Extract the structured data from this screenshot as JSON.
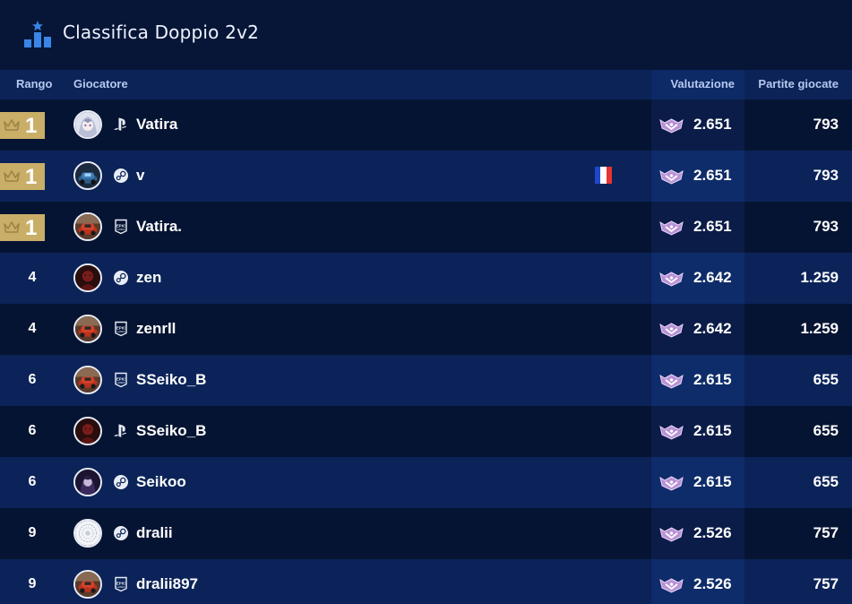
{
  "header": {
    "title": "Classifica Doppio 2v2",
    "icon": "leaderboard-podium-icon"
  },
  "columns": {
    "rank": "Rango",
    "player": "Giocatore",
    "rating": "Valutazione",
    "games": "Partite giocate"
  },
  "colors": {
    "background": "#071637",
    "header_row": "#0b2357",
    "gold_badge": "#c9ae68",
    "row_dark": "#061433",
    "row_light": "#0b2358"
  },
  "rows": [
    {
      "rank": "1",
      "top": true,
      "platform": "playstation-icon",
      "name": "Vatira",
      "flag": "",
      "rating": "2.651",
      "games": "793",
      "avatar": "anime-avatar"
    },
    {
      "rank": "1",
      "top": true,
      "platform": "steam-icon",
      "name": "v",
      "flag": "france-flag",
      "rating": "2.651",
      "games": "793",
      "avatar": "car-avatar-blue"
    },
    {
      "rank": "1",
      "top": true,
      "platform": "epic-games-icon",
      "name": "Vatira.",
      "flag": "",
      "rating": "2.651",
      "games": "793",
      "avatar": "car-avatar-red"
    },
    {
      "rank": "4",
      "top": false,
      "platform": "steam-icon",
      "name": "zen",
      "flag": "",
      "rating": "2.642",
      "games": "1.259",
      "avatar": "dark-red-avatar"
    },
    {
      "rank": "4",
      "top": false,
      "platform": "epic-games-icon",
      "name": "zenrll",
      "flag": "",
      "rating": "2.642",
      "games": "1.259",
      "avatar": "car-avatar-red"
    },
    {
      "rank": "6",
      "top": false,
      "platform": "epic-games-icon",
      "name": "SSeiko_B",
      "flag": "",
      "rating": "2.615",
      "games": "655",
      "avatar": "car-avatar-red"
    },
    {
      "rank": "6",
      "top": false,
      "platform": "playstation-icon",
      "name": "SSeiko_B",
      "flag": "",
      "rating": "2.615",
      "games": "655",
      "avatar": "dark-red-avatar"
    },
    {
      "rank": "6",
      "top": false,
      "platform": "steam-icon",
      "name": "Seikoo",
      "flag": "",
      "rating": "2.615",
      "games": "655",
      "avatar": "purple-avatar"
    },
    {
      "rank": "9",
      "top": false,
      "platform": "steam-icon",
      "name": "dralii",
      "flag": "",
      "rating": "2.526",
      "games": "757",
      "avatar": "white-pattern-avatar"
    },
    {
      "rank": "9",
      "top": false,
      "platform": "epic-games-icon",
      "name": "dralii897",
      "flag": "",
      "rating": "2.526",
      "games": "757",
      "avatar": "car-avatar-red"
    }
  ]
}
